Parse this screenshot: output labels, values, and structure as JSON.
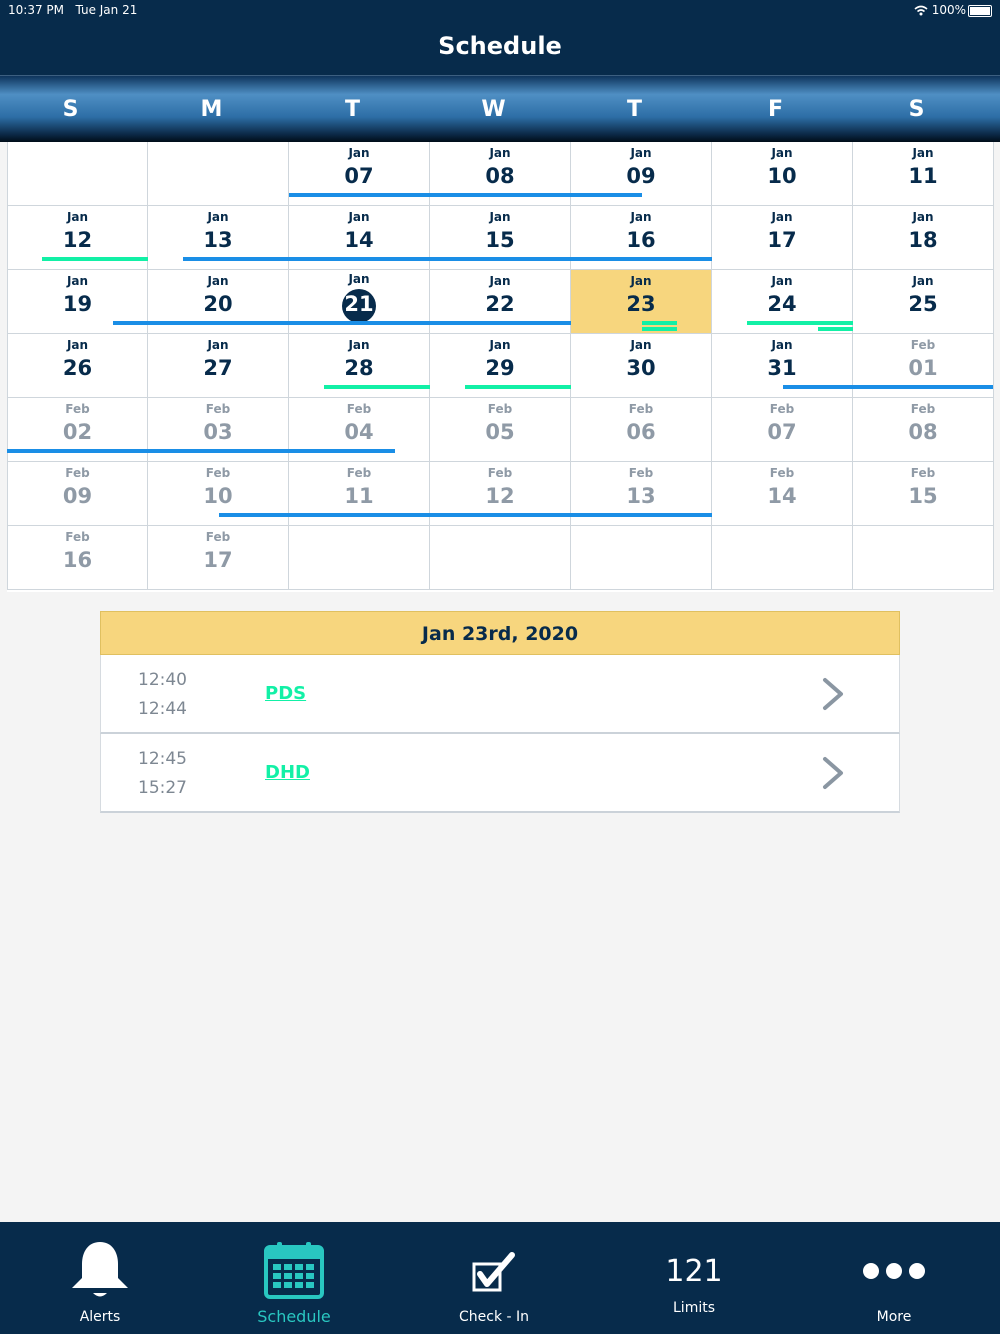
{
  "status_bar": {
    "time": "10:37 PM",
    "date": "Tue Jan 21",
    "battery": "100%"
  },
  "nav": {
    "title": "Schedule"
  },
  "weekdays": [
    "S",
    "M",
    "T",
    "W",
    "T",
    "F",
    "S"
  ],
  "calendar": {
    "cells": [
      {
        "row": 0,
        "col": 2,
        "month": "Jan",
        "day": "07"
      },
      {
        "row": 0,
        "col": 3,
        "month": "Jan",
        "day": "08"
      },
      {
        "row": 0,
        "col": 4,
        "month": "Jan",
        "day": "09"
      },
      {
        "row": 0,
        "col": 5,
        "month": "Jan",
        "day": "10"
      },
      {
        "row": 0,
        "col": 6,
        "month": "Jan",
        "day": "11"
      },
      {
        "row": 1,
        "col": 0,
        "month": "Jan",
        "day": "12"
      },
      {
        "row": 1,
        "col": 1,
        "month": "Jan",
        "day": "13"
      },
      {
        "row": 1,
        "col": 2,
        "month": "Jan",
        "day": "14"
      },
      {
        "row": 1,
        "col": 3,
        "month": "Jan",
        "day": "15"
      },
      {
        "row": 1,
        "col": 4,
        "month": "Jan",
        "day": "16"
      },
      {
        "row": 1,
        "col": 5,
        "month": "Jan",
        "day": "17"
      },
      {
        "row": 1,
        "col": 6,
        "month": "Jan",
        "day": "18"
      },
      {
        "row": 2,
        "col": 0,
        "month": "Jan",
        "day": "19"
      },
      {
        "row": 2,
        "col": 1,
        "month": "Jan",
        "day": "20"
      },
      {
        "row": 2,
        "col": 2,
        "month": "Jan",
        "day": "21",
        "today": true
      },
      {
        "row": 2,
        "col": 3,
        "month": "Jan",
        "day": "22"
      },
      {
        "row": 2,
        "col": 4,
        "month": "Jan",
        "day": "23",
        "selected": true
      },
      {
        "row": 2,
        "col": 5,
        "month": "Jan",
        "day": "24"
      },
      {
        "row": 2,
        "col": 6,
        "month": "Jan",
        "day": "25"
      },
      {
        "row": 3,
        "col": 0,
        "month": "Jan",
        "day": "26"
      },
      {
        "row": 3,
        "col": 1,
        "month": "Jan",
        "day": "27"
      },
      {
        "row": 3,
        "col": 2,
        "month": "Jan",
        "day": "28"
      },
      {
        "row": 3,
        "col": 3,
        "month": "Jan",
        "day": "29"
      },
      {
        "row": 3,
        "col": 4,
        "month": "Jan",
        "day": "30"
      },
      {
        "row": 3,
        "col": 5,
        "month": "Jan",
        "day": "31"
      },
      {
        "row": 3,
        "col": 6,
        "month": "Feb",
        "day": "01",
        "next": true
      },
      {
        "row": 4,
        "col": 0,
        "month": "Feb",
        "day": "02",
        "next": true
      },
      {
        "row": 4,
        "col": 1,
        "month": "Feb",
        "day": "03",
        "next": true
      },
      {
        "row": 4,
        "col": 2,
        "month": "Feb",
        "day": "04",
        "next": true
      },
      {
        "row": 4,
        "col": 3,
        "month": "Feb",
        "day": "05",
        "next": true
      },
      {
        "row": 4,
        "col": 4,
        "month": "Feb",
        "day": "06",
        "next": true
      },
      {
        "row": 4,
        "col": 5,
        "month": "Feb",
        "day": "07",
        "next": true
      },
      {
        "row": 4,
        "col": 6,
        "month": "Feb",
        "day": "08",
        "next": true
      },
      {
        "row": 5,
        "col": 0,
        "month": "Feb",
        "day": "09",
        "next": true
      },
      {
        "row": 5,
        "col": 1,
        "month": "Feb",
        "day": "10",
        "next": true
      },
      {
        "row": 5,
        "col": 2,
        "month": "Feb",
        "day": "11",
        "next": true
      },
      {
        "row": 5,
        "col": 3,
        "month": "Feb",
        "day": "12",
        "next": true
      },
      {
        "row": 5,
        "col": 4,
        "month": "Feb",
        "day": "13",
        "next": true
      },
      {
        "row": 5,
        "col": 5,
        "month": "Feb",
        "day": "14",
        "next": true
      },
      {
        "row": 5,
        "col": 6,
        "month": "Feb",
        "day": "15",
        "next": true
      },
      {
        "row": 6,
        "col": 0,
        "month": "Feb",
        "day": "16",
        "next": true
      },
      {
        "row": 6,
        "col": 1,
        "month": "Feb",
        "day": "17",
        "next": true
      }
    ],
    "empty_cells": [
      {
        "row": 0,
        "col": 0
      },
      {
        "row": 0,
        "col": 1
      },
      {
        "row": 6,
        "col": 2
      },
      {
        "row": 6,
        "col": 3
      },
      {
        "row": 6,
        "col": 4
      },
      {
        "row": 6,
        "col": 5
      },
      {
        "row": 6,
        "col": 6
      }
    ],
    "event_bars": [
      {
        "row": 0,
        "start": 2.0,
        "end": 4.5,
        "color": "blue",
        "lane": 0
      },
      {
        "row": 1,
        "start": 0.25,
        "end": 1.0,
        "color": "green",
        "lane": 0
      },
      {
        "row": 1,
        "start": 1.25,
        "end": 5.0,
        "color": "blue",
        "lane": 0
      },
      {
        "row": 2,
        "start": 0.75,
        "end": 4.0,
        "color": "blue",
        "lane": 0
      },
      {
        "row": 2,
        "start": 4.5,
        "end": 4.75,
        "color": "green",
        "lane": 0
      },
      {
        "row": 2,
        "start": 4.5,
        "end": 4.75,
        "color": "green",
        "lane": 1
      },
      {
        "row": 2,
        "start": 5.25,
        "end": 6.0,
        "color": "green",
        "lane": 0
      },
      {
        "row": 2,
        "start": 5.75,
        "end": 6.0,
        "color": "green",
        "lane": 1
      },
      {
        "row": 3,
        "start": 2.25,
        "end": 3.0,
        "color": "green",
        "lane": 0
      },
      {
        "row": 3,
        "start": 3.25,
        "end": 4.0,
        "color": "green",
        "lane": 0
      },
      {
        "row": 3,
        "start": 5.5,
        "end": 7.0,
        "color": "blue",
        "lane": 0
      },
      {
        "row": 4,
        "start": 0.0,
        "end": 2.75,
        "color": "blue",
        "lane": 0
      },
      {
        "row": 5,
        "start": 1.5,
        "end": 5.0,
        "color": "blue",
        "lane": 0
      }
    ]
  },
  "events": {
    "header": "Jan 23rd, 2020",
    "items": [
      {
        "start": "12:40",
        "end": "12:44",
        "code": "PDS"
      },
      {
        "start": "12:45",
        "end": "15:27",
        "code": "DHD"
      }
    ]
  },
  "tabs": [
    {
      "label": "Alerts",
      "icon": "bell-icon"
    },
    {
      "label": "Schedule",
      "icon": "calendar-icon",
      "active": true
    },
    {
      "label": "Check - In",
      "icon": "checkbox-icon"
    },
    {
      "label": "Limits",
      "count": "121"
    },
    {
      "label": "More",
      "icon": "more-icon"
    }
  ],
  "colors": {
    "navy": "#072b4b",
    "selected": "#f7d67e",
    "bar_blue": "#1a8ee6",
    "bar_green": "#12f0a6",
    "tab_active": "#29c7c1"
  }
}
